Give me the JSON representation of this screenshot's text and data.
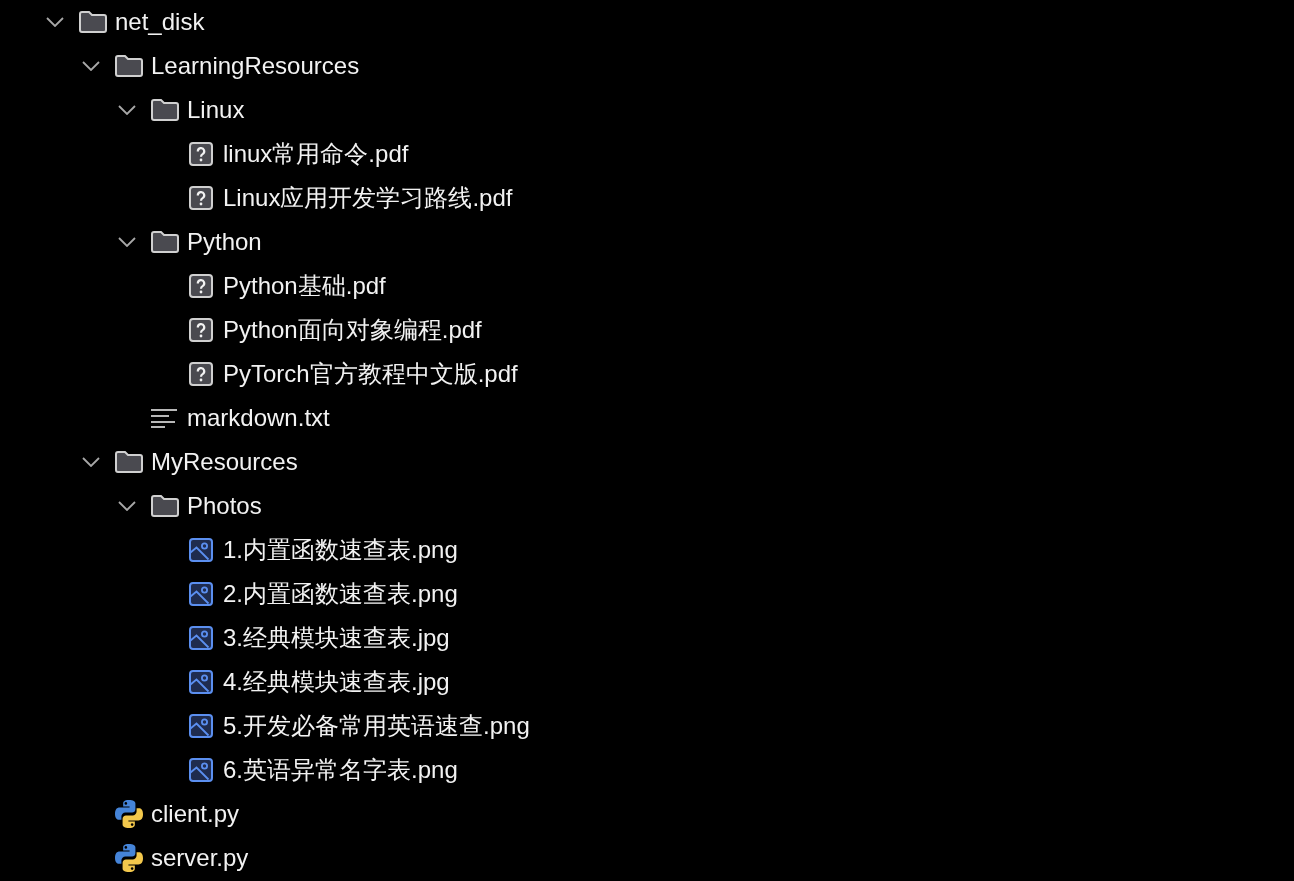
{
  "tree": [
    {
      "kind": "folder",
      "name": "net_disk",
      "expanded": true,
      "children": [
        {
          "kind": "folder",
          "name": "LearningResources",
          "expanded": true,
          "children": [
            {
              "kind": "folder",
              "name": "Linux",
              "expanded": true,
              "children": [
                {
                  "kind": "unknown",
                  "name": "linux常用命令.pdf"
                },
                {
                  "kind": "unknown",
                  "name": "Linux应用开发学习路线.pdf"
                }
              ]
            },
            {
              "kind": "folder",
              "name": "Python",
              "expanded": true,
              "children": [
                {
                  "kind": "unknown",
                  "name": "Python基础.pdf"
                },
                {
                  "kind": "unknown",
                  "name": "Python面向对象编程.pdf"
                },
                {
                  "kind": "unknown",
                  "name": "PyTorch官方教程中文版.pdf"
                }
              ]
            },
            {
              "kind": "text",
              "name": "markdown.txt"
            }
          ]
        },
        {
          "kind": "folder",
          "name": "MyResources",
          "expanded": true,
          "children": [
            {
              "kind": "folder",
              "name": "Photos",
              "expanded": true,
              "children": [
                {
                  "kind": "image",
                  "name": "1.内置函数速查表.png"
                },
                {
                  "kind": "image",
                  "name": "2.内置函数速查表.png"
                },
                {
                  "kind": "image",
                  "name": "3.经典模块速查表.jpg"
                },
                {
                  "kind": "image",
                  "name": "4.经典模块速查表.jpg"
                },
                {
                  "kind": "image",
                  "name": "5.开发必备常用英语速查.png"
                },
                {
                  "kind": "image",
                  "name": "6.英语异常名字表.png"
                }
              ]
            }
          ]
        },
        {
          "kind": "python",
          "name": "client.py"
        },
        {
          "kind": "python",
          "name": "server.py"
        }
      ]
    }
  ]
}
